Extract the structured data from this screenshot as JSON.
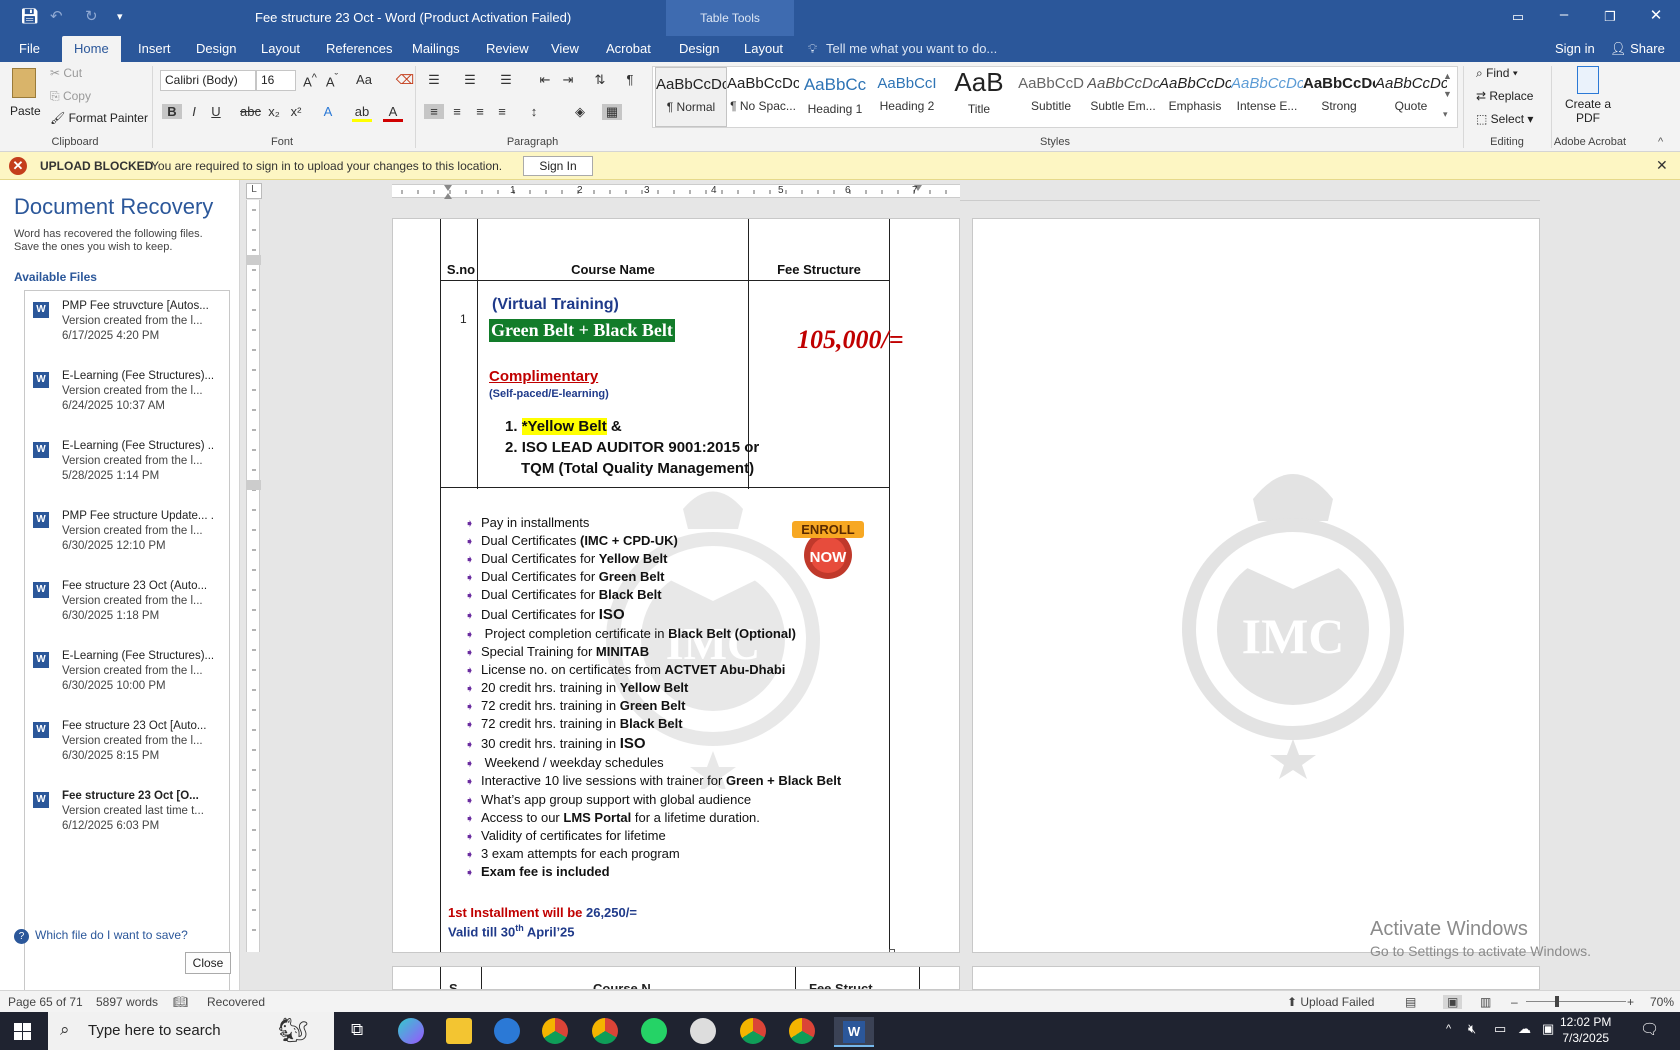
{
  "titlebar": {
    "doc_title": "Fee structure 23 Oct - Word (Product Activation Failed)",
    "table_tools": "Table Tools"
  },
  "tabs": {
    "file": "File",
    "home": "Home",
    "insert": "Insert",
    "design": "Design",
    "layout": "Layout",
    "references": "References",
    "mailings": "Mailings",
    "review": "Review",
    "view": "View",
    "acrobat": "Acrobat",
    "tt_design": "Design",
    "tt_layout": "Layout",
    "tell_me": "Tell me what you want to do...",
    "sign_in": "Sign in",
    "share": "Share"
  },
  "ribbon": {
    "clipboard": {
      "paste": "Paste",
      "cut": "Cut",
      "copy": "Copy",
      "format_painter": "Format Painter",
      "label": "Clipboard"
    },
    "font": {
      "name": "Calibri (Body)",
      "size": "16",
      "label": "Font"
    },
    "paragraph": {
      "label": "Paragraph"
    },
    "styles": {
      "label": "Styles",
      "items": [
        {
          "sample": "AaBbCcDc",
          "name": "¶ Normal"
        },
        {
          "sample": "AaBbCcDc",
          "name": "¶ No Spac..."
        },
        {
          "sample": "AaBbCc",
          "name": "Heading 1"
        },
        {
          "sample": "AaBbCcI",
          "name": "Heading 2"
        },
        {
          "sample": "AaB",
          "name": "Title"
        },
        {
          "sample": "AaBbCcD",
          "name": "Subtitle"
        },
        {
          "sample": "AaBbCcDc",
          "name": "Subtle Em..."
        },
        {
          "sample": "AaBbCcDc",
          "name": "Emphasis"
        },
        {
          "sample": "AaBbCcDc",
          "name": "Intense E..."
        },
        {
          "sample": "AaBbCcDc",
          "name": "Strong"
        },
        {
          "sample": "AaBbCcDc",
          "name": "Quote"
        }
      ]
    },
    "editing": {
      "find": "Find",
      "replace": "Replace",
      "select": "Select",
      "label": "Editing"
    },
    "acrobat": {
      "create_pdf": "Create a PDF",
      "label": "Adobe Acrobat"
    }
  },
  "message_bar": {
    "title": "UPLOAD BLOCKED",
    "text": "You are required to sign in to upload your changes to this location.",
    "button": "Sign In"
  },
  "recovery": {
    "title": "Document Recovery",
    "desc1": "Word has recovered the following files.",
    "desc2": "Save the ones you wish to keep.",
    "available": "Available Files",
    "files": [
      {
        "name": "PMP Fee struvcture  [Autos...",
        "note": "Version created from the l...",
        "date": "6/17/2025 4:20 PM"
      },
      {
        "name": "E-Learning (Fee Structures)...",
        "note": "Version created from the l...",
        "date": "6/24/2025 10:37 AM"
      },
      {
        "name": "E-Learning (Fee Structures) ..",
        "note": "Version created from the l...",
        "date": "5/28/2025 1:14 PM"
      },
      {
        "name": "PMP Fee structure Update... .",
        "note": "Version created from the l...",
        "date": "6/30/2025 12:10 PM"
      },
      {
        "name": "Fee structure 23 Oct (Auto...",
        "note": "Version created from the l...",
        "date": "6/30/2025 1:18 PM"
      },
      {
        "name": "E-Learning (Fee Structures)...",
        "note": "Version created from the l...",
        "date": "6/30/2025 10:00 PM"
      },
      {
        "name": "Fee structure 23 Oct  [Auto...",
        "note": "Version created from the l...",
        "date": "6/30/2025 8:15 PM"
      },
      {
        "name": "Fee structure 23 Oct  [O...",
        "note": "Version created last time t...",
        "date": "6/12/2025 6:03 PM"
      }
    ],
    "which": "Which file do I want to save?",
    "close": "Close"
  },
  "document": {
    "head_sno": "S.no",
    "head_course": "Course Name",
    "head_fee": "Fee Structure",
    "sno": "1",
    "virtual": "(Virtual Training)",
    "gbb": "Green Belt + Black Belt",
    "fee": "105,000/=",
    "complimentary": "Complimentary",
    "self_paced": "(Self-paced/E-learning)",
    "ol1_hl": "*Yellow Belt",
    "ol1_rest": " &",
    "ol2a": "ISO LEAD AUDITOR 9001:2015 or",
    "ol2b": "TQM (Total Quality Management)",
    "enroll_top": "ENROLL",
    "enroll_bottom": "NOW",
    "bullets": [
      {
        "pre": "Pay in installments",
        "bold": "",
        "post": ""
      },
      {
        "pre": "Dual Certificates ",
        "bold": "(IMC + CPD-UK)",
        "post": ""
      },
      {
        "pre": "Dual Certificates for ",
        "bold": "Yellow Belt",
        "post": ""
      },
      {
        "pre": "Dual Certificates for ",
        "bold": "Green Belt",
        "post": ""
      },
      {
        "pre": "Dual Certificates for ",
        "bold": "Black Belt",
        "post": ""
      },
      {
        "pre": "Dual Certificates for  ",
        "bold": "ISO",
        "post": ""
      },
      {
        "pre": " Project completion certificate in ",
        "bold": "Black Belt",
        "post": " (Optional)"
      },
      {
        "pre": "Special Training for ",
        "bold": "MINITAB",
        "post": ""
      },
      {
        "pre": "License no. on certificates from ",
        "bold": "",
        "post": "ACTVET Abu-Dhabi"
      },
      {
        "pre": "20 credit hrs. training in ",
        "bold": "Yellow Belt",
        "post": ""
      },
      {
        "pre": "72 credit hrs. training in ",
        "bold": "Green Belt",
        "post": ""
      },
      {
        "pre": "72 credit hrs. training in ",
        "bold": "Black Belt",
        "post": ""
      },
      {
        "pre": "30 credit hrs. training in  ",
        "bold": "ISO",
        "post": ""
      },
      {
        "pre": " Weekend / weekday schedules",
        "bold": "",
        "post": ""
      },
      {
        "pre": "Interactive 10 live sessions with trainer for ",
        "bold": "Green + Black Belt",
        "post": ""
      },
      {
        "pre": "What’s app group support with global audience",
        "bold": "",
        "post": ""
      },
      {
        "pre": "Access to our ",
        "bold": "LMS Portal",
        "post": " for a lifetime duration."
      },
      {
        "pre": "Validity of certificates for lifetime",
        "bold": "",
        "post": ""
      },
      {
        "pre": "3 exam attempts for each program",
        "bold": "",
        "post": ""
      },
      {
        "pre": "",
        "bold": "Exam fee is included",
        "post": ""
      }
    ],
    "inst_label": "1st Installment will be ",
    "inst_amount": "26,250/=",
    "valid_a": "Valid till 30",
    "valid_sup": "th",
    "valid_b": " April’25",
    "watermark": "IMC",
    "next_head_sno": "S",
    "next_head_course": "Course N",
    "next_head_fee": "Fee Struct"
  },
  "activate": {
    "line1": "Activate Windows",
    "line2": "Go to Settings to activate Windows."
  },
  "status": {
    "page": "Page 65 of 71",
    "words": "5897 words",
    "recovered": "Recovered",
    "upload": "Upload Failed",
    "zoom": "70%"
  },
  "taskbar": {
    "search": "Type here to search",
    "time": "12:02 PM",
    "date": "7/3/2025"
  }
}
